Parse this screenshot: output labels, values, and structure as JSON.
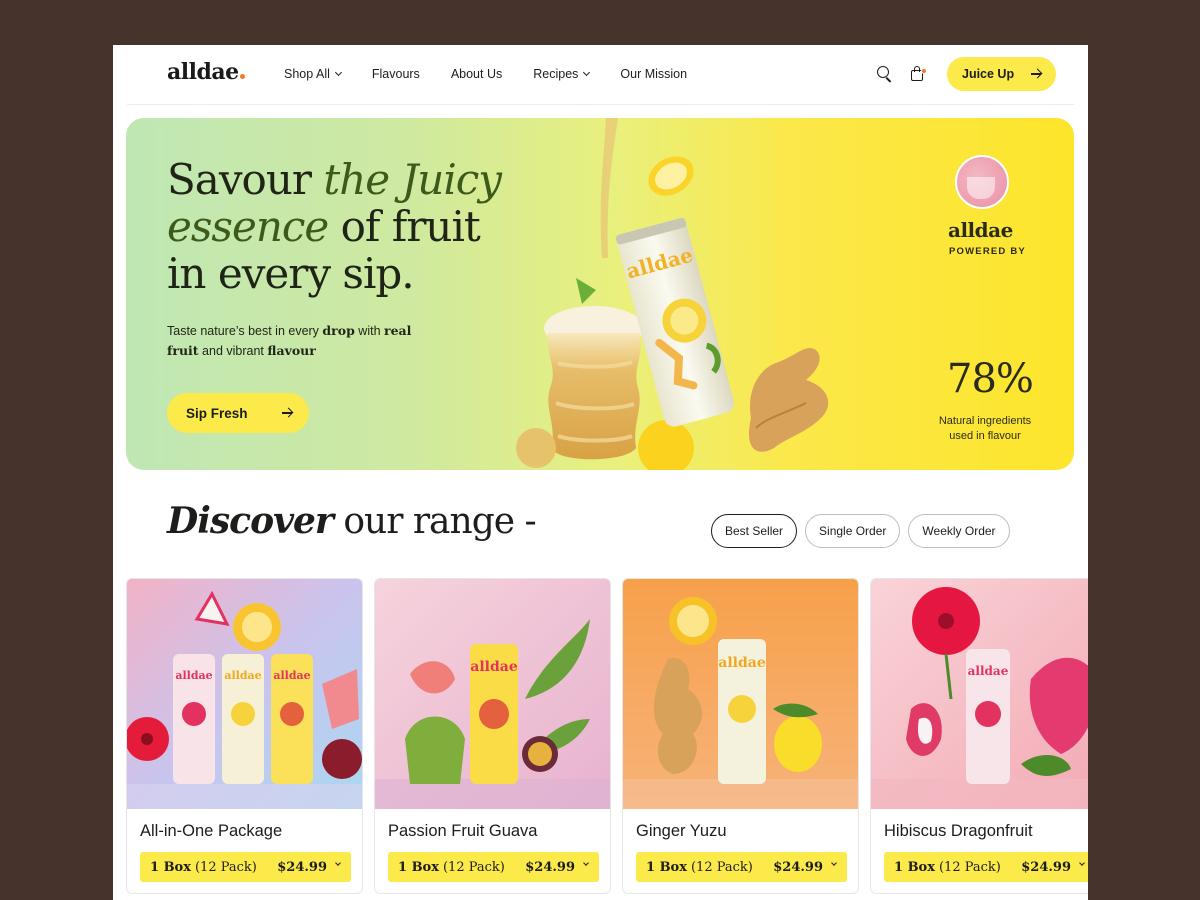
{
  "nav": {
    "logo": "alldae",
    "links": [
      {
        "label": "Shop All",
        "dropdown": true
      },
      {
        "label": "Flavours",
        "dropdown": false
      },
      {
        "label": "About Us",
        "dropdown": false
      },
      {
        "label": "Recipes",
        "dropdown": true
      },
      {
        "label": "Our Mission",
        "dropdown": false
      }
    ],
    "cta_label": "Juice Up"
  },
  "hero": {
    "title_1": "Savour ",
    "title_italic": "the Juicy essence",
    "title_2": " of fruit in every sip.",
    "subtitle_1": "Taste nature’s best in every ",
    "subtitle_b1": "drop",
    "subtitle_2": " with ",
    "subtitle_b2": "real fruit",
    "subtitle_3": " and vibrant ",
    "subtitle_b3": "flavour",
    "cta_label": "Sip Fresh",
    "can_brand": "alldae",
    "brand_name": "alldae",
    "brand_powered": "POWERED BY",
    "stat_value": "78%",
    "stat_label": "Natural ingredients used in flavour"
  },
  "discover": {
    "title_italic": "Discover",
    "title_rest": " our range -",
    "filters": [
      "Best Seller",
      "Single Order",
      "Weekly Order"
    ],
    "active_filter": "Best Seller"
  },
  "products": [
    {
      "name": "All-in-One Package",
      "box": "1 Box",
      "pack": "(12 Pack)",
      "price": "$24.99",
      "bg": "#b9c8ec"
    },
    {
      "name": "Passion Fruit Guava",
      "box": "1 Box",
      "pack": "(12 Pack)",
      "price": "$24.99",
      "bg": "#eec6d6"
    },
    {
      "name": "Ginger Yuzu",
      "box": "1 Box",
      "pack": "(12 Pack)",
      "price": "$24.99",
      "bg": "#f6a355"
    },
    {
      "name": "Hibiscus Dragonfruit",
      "box": "1 Box",
      "pack": "(12 Pack)",
      "price": "$24.99",
      "bg": "#f7c7d0"
    }
  ],
  "colors": {
    "accent_yellow": "#fbea4a",
    "logo_dot": "#f07a2b",
    "frame": "#45332c"
  }
}
